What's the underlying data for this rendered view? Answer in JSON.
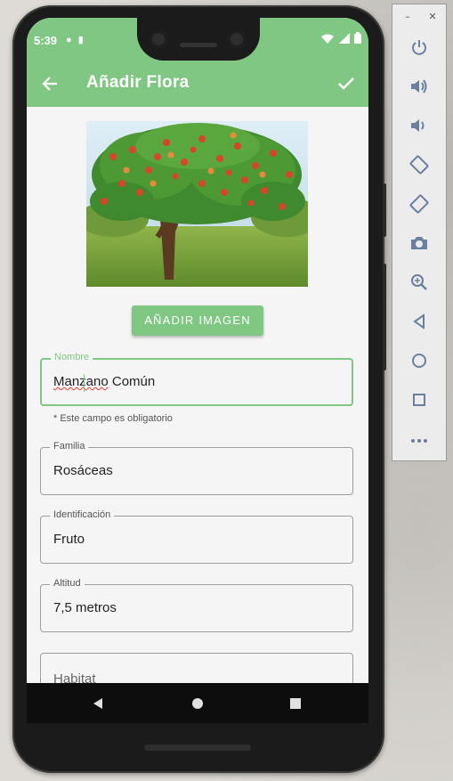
{
  "status_bar": {
    "time": "5:39",
    "left_icons": [
      "notification-icon",
      "sd-card-icon"
    ],
    "right_icons": [
      "wifi-icon",
      "signal-icon",
      "battery-icon"
    ]
  },
  "app_bar": {
    "title": "Añadir Flora",
    "back_icon": "arrow-back-icon",
    "confirm_icon": "check-icon"
  },
  "image": {
    "description_icon": "apple-tree-photo"
  },
  "add_image_button": "AÑADIR IMAGEN",
  "form": {
    "nombre": {
      "label": "Nombre",
      "value_misspelled": "Manzano",
      "value_rest": " Común",
      "helper": "* Este campo es obligatorio"
    },
    "familia": {
      "label": "Familia",
      "value": "Rosáceas"
    },
    "identificacion": {
      "label": "Identificación",
      "value": "Fruto"
    },
    "altitud": {
      "label": "Altitud",
      "value": "7,5 metros"
    },
    "habitat": {
      "placeholder": "Habitat"
    }
  },
  "nav_bar": [
    "back-triangle-icon",
    "home-circle-icon",
    "recents-square-icon"
  ],
  "colors": {
    "primary": "#81c784",
    "error_underline": "#e53935",
    "background": "#f5f5f5"
  },
  "emulator_toolbar": {
    "window_controls": [
      "minimize-icon",
      "close-icon"
    ],
    "tools": [
      "power-icon",
      "volume-up-icon",
      "volume-down-icon",
      "rotate-left-icon",
      "rotate-right-icon",
      "camera-icon",
      "zoom-icon",
      "back-icon",
      "home-icon",
      "overview-icon",
      "more-icon"
    ]
  }
}
